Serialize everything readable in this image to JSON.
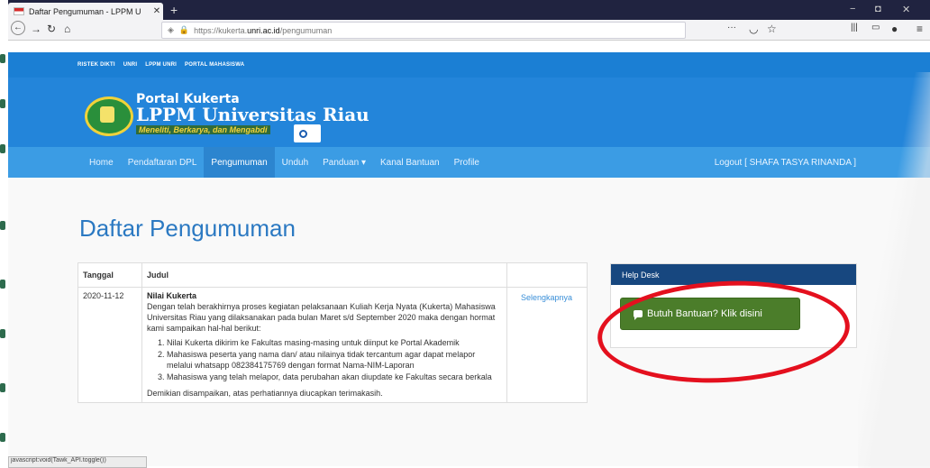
{
  "browser": {
    "tab_title": "Daftar Pengumuman - LPPM U",
    "tab_close": "✕",
    "new_tab": "+",
    "url_prefix": "https://kukerta.",
    "url_domain": "unri.ac.id",
    "url_path": "/pengumuman",
    "more": "···",
    "win_min": "−",
    "win_max": "◘",
    "win_close": "✕"
  },
  "site": {
    "top_links": [
      "RISTEK DIKTI",
      "UNRI",
      "LPPM UNRI",
      "PORTAL MAHASISWA"
    ],
    "header_small": "Portal Kukerta",
    "header_big": "LPPM Universitas Riau",
    "motto": "Meneliti, Berkarya, dan Mengabdi",
    "menu": [
      "Home",
      "Pendaftaran DPL",
      "Pengumuman",
      "Unduh",
      "Panduan ▾",
      "Kanal Bantuan",
      "Profile"
    ],
    "logout": "Logout [ SHAFA TASYA RINANDA ]"
  },
  "page": {
    "title": "Daftar Pengumuman",
    "col_tanggal": "Tanggal",
    "col_judul": "Judul",
    "row": {
      "date": "2020-11-12",
      "title": "Nilai Kukerta",
      "intro": "Dengan telah berakhirnya proses kegiatan pelaksanaan Kuliah Kerja Nyata (Kukerta) Mahasiswa Universitas Riau yang dilaksanakan pada bulan Maret s/d September 2020 maka dengan hormat kami sampaikan hal-hal berikut:",
      "items": [
        "Nilai Kukerta dikirim ke Fakultas masing-masing untuk diinput ke Portal Akademik",
        "Mahasiswa peserta yang nama dan/ atau nilainya tidak tercantum agar dapat melapor melalui whatsapp 082384175769 dengan format Nama-NIM-Laporan",
        "Mahasiswa yang telah melapor, data perubahan akan diupdate ke Fakultas secara berkala"
      ],
      "closing": "Demikian disampaikan, atas perhatiannya diucapkan terimakasih.",
      "link": "Selengkapnya"
    }
  },
  "helpdesk": {
    "title": "Help Desk",
    "button": "Butuh Bantuan? Klik disini"
  },
  "status_bar": "javascript:void(Tawk_API.toggle())",
  "colors": {
    "accent": "#2385da",
    "help_button": "#4b7d2a",
    "annotation_circle": "#e4101e"
  }
}
